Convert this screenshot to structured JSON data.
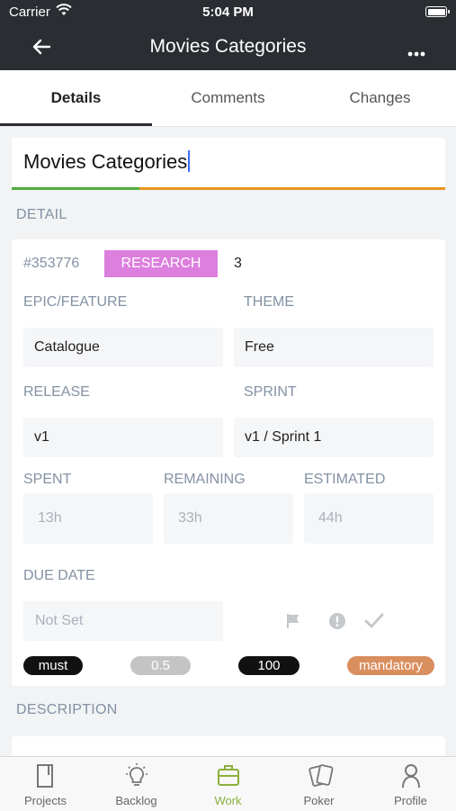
{
  "status_bar": {
    "carrier": "Carrier",
    "time": "5:04 PM"
  },
  "nav": {
    "title": "Movies Categories"
  },
  "tabs": [
    {
      "label": "Details"
    },
    {
      "label": "Comments"
    },
    {
      "label": "Changes"
    }
  ],
  "story": {
    "title": "Movies Categories"
  },
  "detail": {
    "section_label": "DETAIL",
    "id": "#353776",
    "type_badge": "RESEARCH",
    "points": "3",
    "epic_label": "EPIC/FEATURE",
    "epic_value": "Catalogue",
    "theme_label": "THEME",
    "theme_value": "Free",
    "release_label": "RELEASE",
    "release_value": "v1",
    "sprint_label": "SPRINT",
    "sprint_value": "v1 / Sprint 1",
    "spent_label": "SPENT",
    "spent_value": "13h",
    "remaining_label": "REMAINING",
    "remaining_value": "33h",
    "estimated_label": "ESTIMATED",
    "estimated_value": "44h",
    "due_label": "DUE DATE",
    "due_placeholder": "Not Set",
    "tags": [
      "must",
      "0.5",
      "100",
      "mandatory"
    ]
  },
  "description": {
    "section_label": "DESCRIPTION"
  },
  "bottom_nav": [
    {
      "label": "Projects"
    },
    {
      "label": "Backlog"
    },
    {
      "label": "Work"
    },
    {
      "label": "Poker"
    },
    {
      "label": "Profile"
    }
  ],
  "colors": {
    "nav_bg": "#2a2d31",
    "research_badge": "#dc7fde",
    "progress_green": "#4caf3c",
    "progress_orange": "#e8951e",
    "active_tab": "#8bb03d",
    "tag_black": "#111111",
    "tag_grey": "#c4c4c4",
    "tag_mandatory": "#d98e5e"
  }
}
